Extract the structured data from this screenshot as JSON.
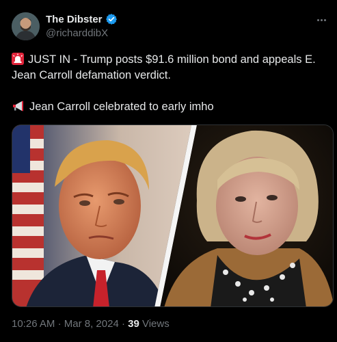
{
  "author": {
    "display_name": "The Dibster",
    "handle": "@richarddibX",
    "verified_color": "#1d9bf0"
  },
  "tweet": {
    "line1": "JUST IN - Trump posts $91.6 million bond and appeals E.",
    "line2": "Jean Carroll defamation verdict.",
    "line3": "Jean Carroll celebrated to early imho"
  },
  "footer": {
    "time": "10:26 AM",
    "date": "Mar 8, 2024",
    "separator": "·",
    "views_count": "39",
    "views_label": "Views"
  },
  "icons": [
    "rotating-light-icon",
    "megaphone-icon",
    "verified-badge-icon",
    "more-icon"
  ]
}
